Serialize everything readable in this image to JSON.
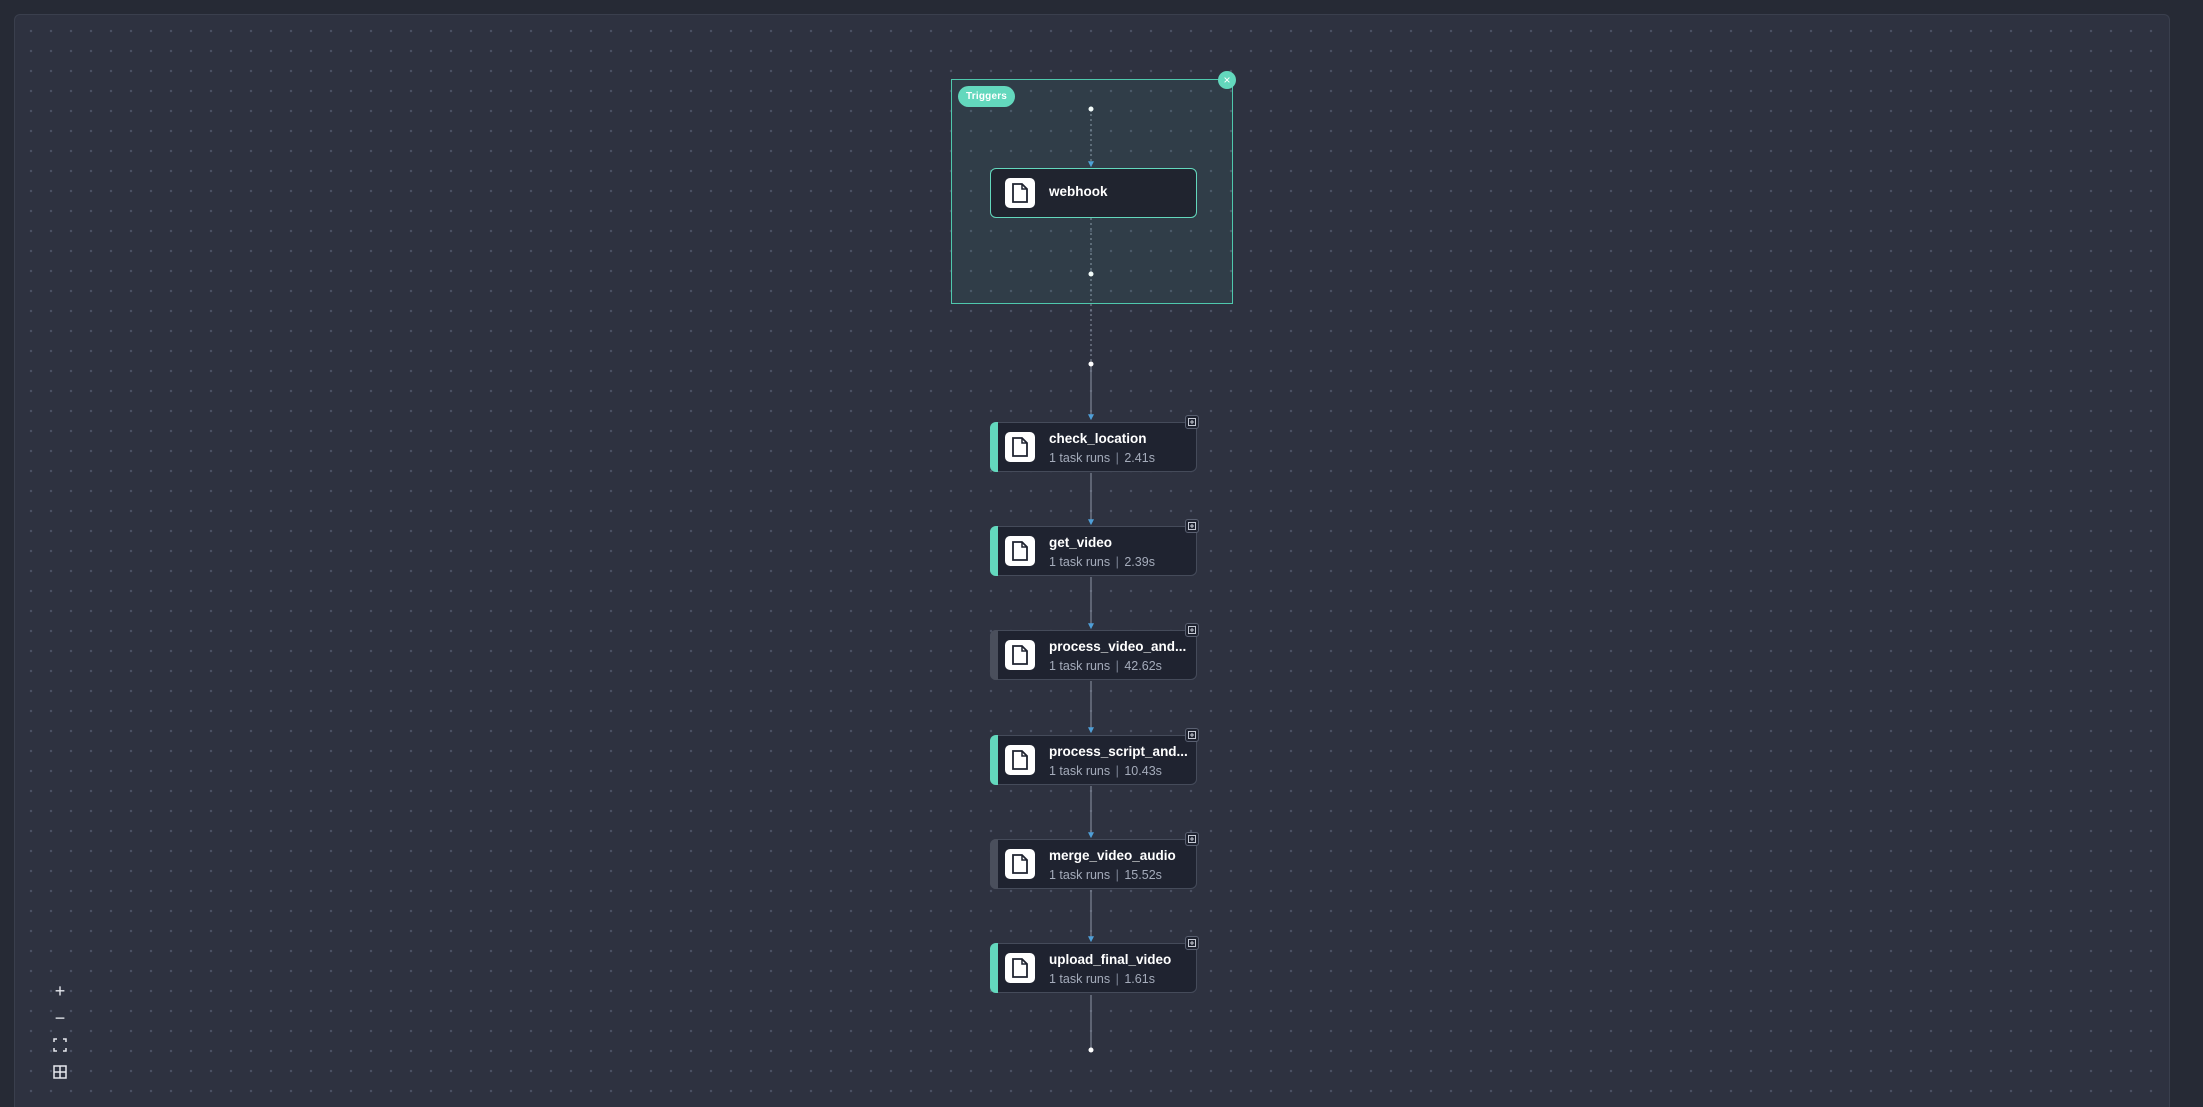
{
  "canvas": {
    "trigger_group_label": "Triggers",
    "trigger_node": {
      "label": "webhook",
      "icon": "document-icon"
    },
    "tasks": [
      {
        "name": "check_location",
        "runs": "1 task runs",
        "duration": "2.41s",
        "status_color": "#63d8bd"
      },
      {
        "name": "get_video",
        "runs": "1 task runs",
        "duration": "2.39s",
        "status_color": "#63d8bd"
      },
      {
        "name": "process_video_and...",
        "runs": "1 task runs",
        "duration": "42.62s",
        "status_color": "#4a4f5c"
      },
      {
        "name": "process_script_and...",
        "runs": "1 task runs",
        "duration": "10.43s",
        "status_color": "#63d8bd"
      },
      {
        "name": "merge_video_audio",
        "runs": "1 task runs",
        "duration": "15.52s",
        "status_color": "#4a4f5c"
      },
      {
        "name": "upload_final_video",
        "runs": "1 task runs",
        "duration": "1.61s",
        "status_color": "#63d8bd"
      }
    ],
    "separator": "|"
  },
  "controls": [
    {
      "name": "zoom-in",
      "icon": "plus-icon",
      "glyph": "+"
    },
    {
      "name": "zoom-out",
      "icon": "minus-icon",
      "glyph": "−"
    },
    {
      "name": "fit-view",
      "icon": "fit-view-icon"
    },
    {
      "name": "toggle-interactivity",
      "icon": "grid-icon"
    }
  ],
  "colors": {
    "accent": "#63d8bd",
    "edge": "#4f9fd8",
    "background": "#2e3240",
    "node": "#1f2330"
  }
}
